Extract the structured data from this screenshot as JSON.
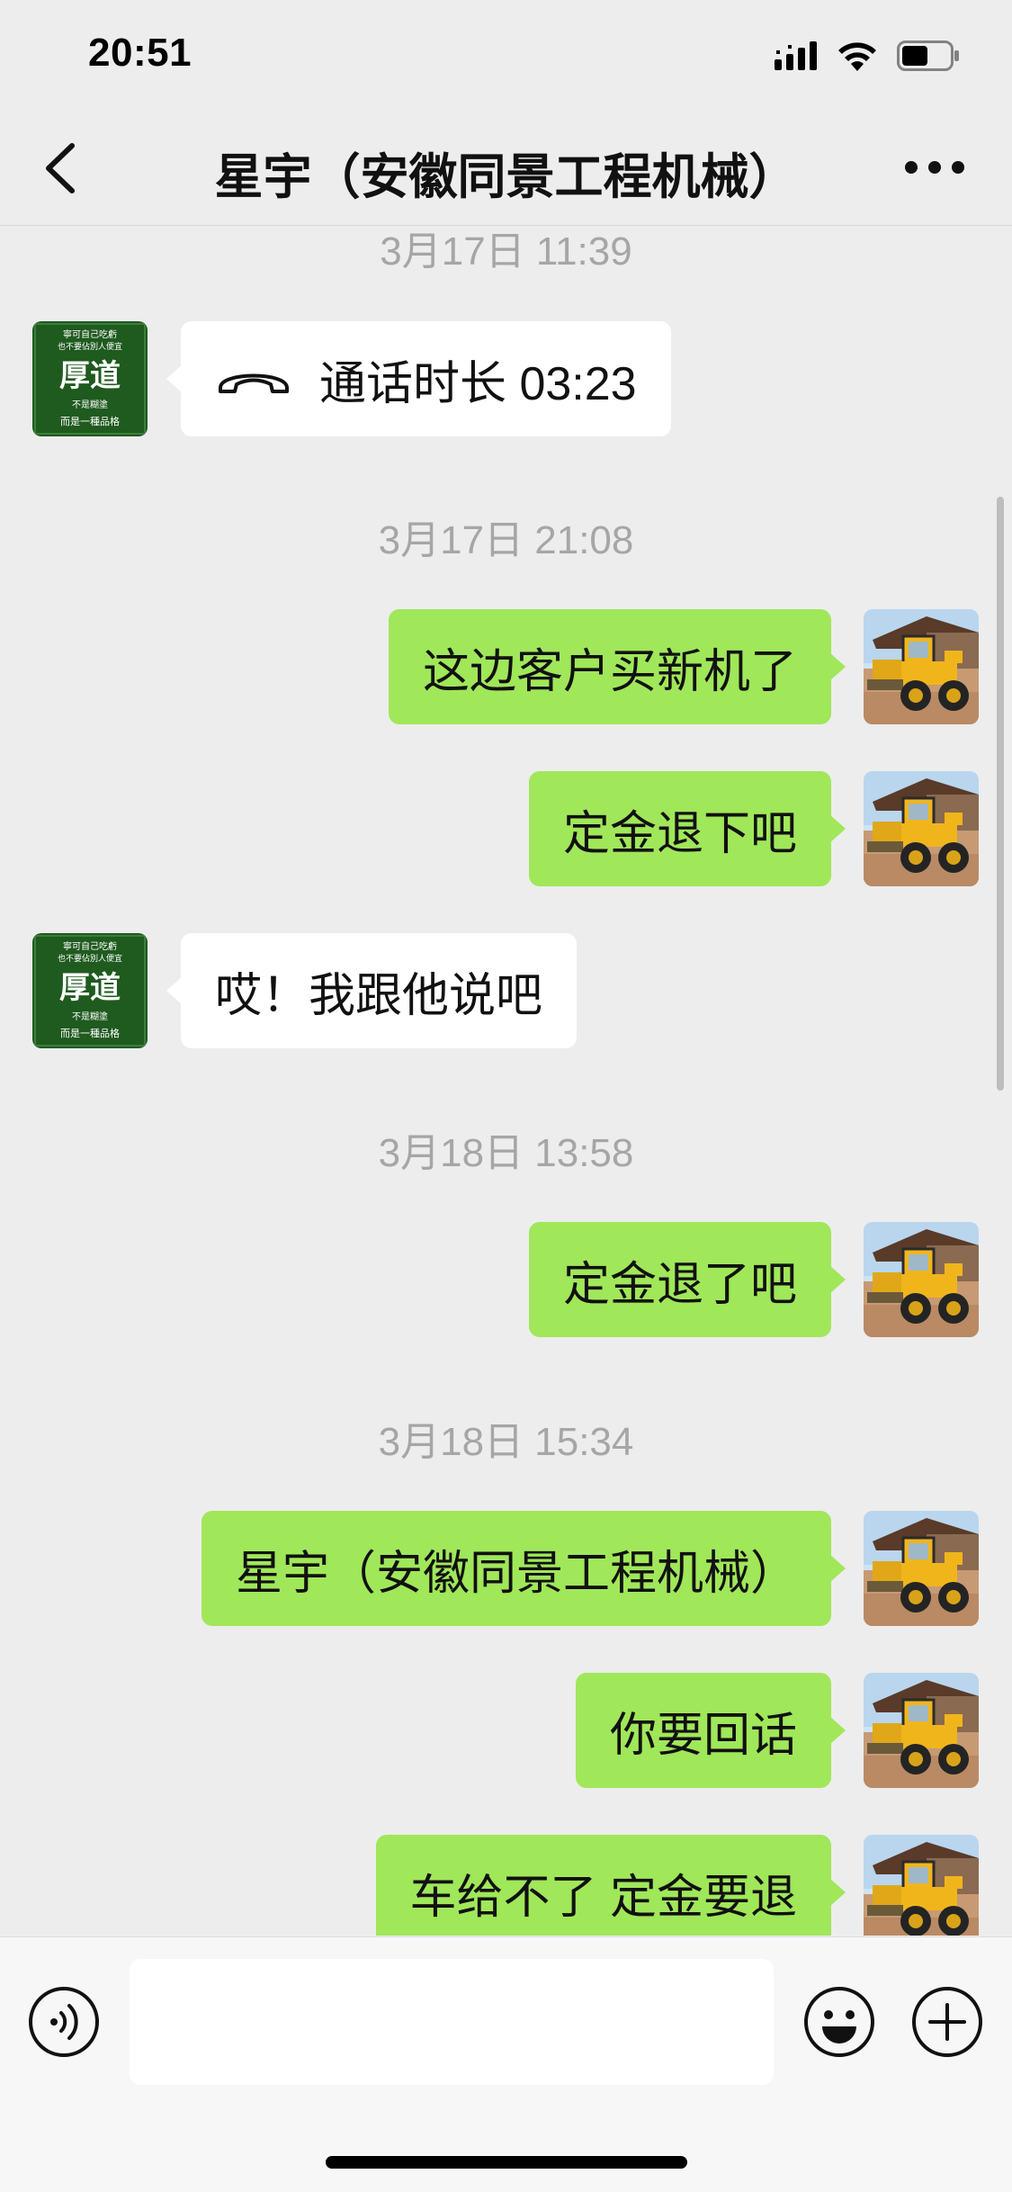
{
  "status_bar": {
    "time": "20:51",
    "icons": [
      "signal-icon",
      "wifi-icon",
      "battery-icon"
    ]
  },
  "header": {
    "title": "星宇（安徽同景工程机械）",
    "back_icon": "chevron-left-icon",
    "more_icon": "ellipsis-icon"
  },
  "contact_avatar": {
    "lines": [
      "寧可自己吃虧",
      "也不要佔別人便宜",
      "厚道",
      "不是糊塗",
      "而是一種品格"
    ],
    "colors": {
      "bg": "#1f5a1f",
      "text": "#ffffff"
    }
  },
  "colors": {
    "background": "#ededed",
    "bubble_self": "#a0e75a",
    "bubble_other": "#ffffff",
    "timestamp": "#a6a6a6"
  },
  "messages": [
    {
      "type": "timestamp",
      "text": "3月17日 11:39"
    },
    {
      "type": "call",
      "sender": "other",
      "text": "通话时长 03:23",
      "icon": "phone-hangup-icon"
    },
    {
      "type": "timestamp",
      "text": "3月17日 21:08"
    },
    {
      "type": "text",
      "sender": "self",
      "text": "这边客户买新机了"
    },
    {
      "type": "text",
      "sender": "self",
      "text": "定金退下吧"
    },
    {
      "type": "text",
      "sender": "other",
      "text": "哎！我跟他说吧"
    },
    {
      "type": "timestamp",
      "text": "3月18日 13:58"
    },
    {
      "type": "text",
      "sender": "self",
      "text": "定金退了吧"
    },
    {
      "type": "timestamp",
      "text": "3月18日 15:34"
    },
    {
      "type": "text",
      "sender": "self",
      "text": "星宇（安徽同景工程机械）"
    },
    {
      "type": "text",
      "sender": "self",
      "text": "你要回话"
    },
    {
      "type": "text",
      "sender": "self",
      "text": "车给不了 定金要退"
    }
  ],
  "input_bar": {
    "value": "",
    "voice_icon": "voice-icon",
    "emoji_icon": "emoji-icon",
    "plus_icon": "plus-icon"
  }
}
